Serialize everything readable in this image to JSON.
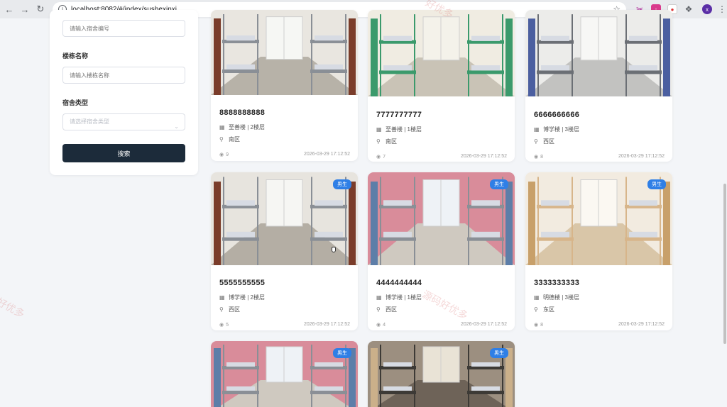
{
  "browser": {
    "url": "localhost:8082/#/index/sushexinxi"
  },
  "search_panel": {
    "room_number_placeholder": "请输入宿舍编号",
    "building_label": "楼栋名称",
    "building_placeholder": "请输入楼栋名称",
    "type_label": "宿舍类型",
    "type_placeholder": "请选择宿舍类型",
    "search_button": "搜索"
  },
  "cards": [
    {
      "room": "8888888888",
      "building_floor": "至善楼 | 2楼层",
      "area": "南区",
      "views": "9",
      "time": "2026-03-29 17:12:52",
      "badge": ""
    },
    {
      "room": "7777777777",
      "building_floor": "至善楼 | 1楼层",
      "area": "南区",
      "views": "7",
      "time": "2026-03-29 17:12:52",
      "badge": ""
    },
    {
      "room": "6666666666",
      "building_floor": "博学楼 | 3楼层",
      "area": "西区",
      "views": "8",
      "time": "2026-03-29 17:12:52",
      "badge": ""
    },
    {
      "room": "5555555555",
      "building_floor": "博学楼 | 2楼层",
      "area": "西区",
      "views": "5",
      "time": "2026-03-29 17:12:52",
      "badge": "男生"
    },
    {
      "room": "4444444444",
      "building_floor": "博学楼 | 1楼层",
      "area": "西区",
      "views": "4",
      "time": "2026-03-29 17:12:52",
      "badge": "男生"
    },
    {
      "room": "3333333333",
      "building_floor": "明德楼 | 3楼层",
      "area": "东区",
      "views": "8",
      "time": "2026-03-29 17:12:52",
      "badge": "男生"
    },
    {
      "room": "",
      "building_floor": "",
      "area": "",
      "views": "",
      "time": "",
      "badge": "男生"
    },
    {
      "room": "",
      "building_floor": "",
      "area": "",
      "views": "",
      "time": "",
      "badge": "男生"
    }
  ],
  "watermarks": [
    "好优多",
    "源码好优多",
    "好优多"
  ],
  "colors": {
    "search_button": "#1c2b3a",
    "badge": "#2f7fe6",
    "page_background": "#f3f5f8"
  }
}
